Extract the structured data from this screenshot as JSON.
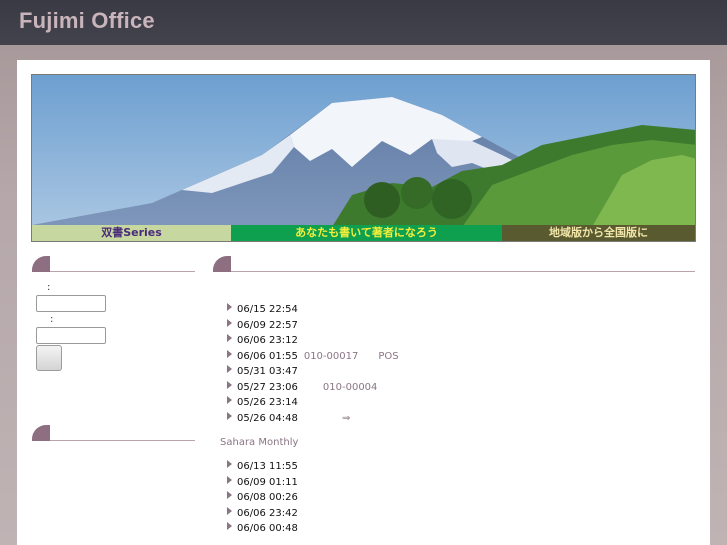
{
  "header": {
    "site_title": "Fujimi Office"
  },
  "banner": {
    "strip": [
      "双書Series",
      "あなたも書いて著者になろう",
      "地域版から全国版に"
    ]
  },
  "sidebar": {
    "login": {
      "label1": ":",
      "label2": ":",
      "field1_value": "",
      "field2_value": "",
      "button_label": ""
    }
  },
  "main": {
    "list1": [
      {
        "time": "06/15 22:54",
        "extra": "",
        "extra2": ""
      },
      {
        "time": "06/09 22:57",
        "extra": "",
        "extra2": ""
      },
      {
        "time": "06/06 23:12",
        "extra": "",
        "extra2": ""
      },
      {
        "time": "06/06 01:55",
        "extra": "010-00017",
        "extra2": "POS"
      },
      {
        "time": "05/31 03:47",
        "extra": "",
        "extra2": ""
      },
      {
        "time": "05/27 23:06",
        "extra": "      010-00004",
        "extra2": ""
      },
      {
        "time": "05/26 23:14",
        "extra": "",
        "extra2": ""
      },
      {
        "time": "05/26 04:48",
        "extra": "            ⇒",
        "extra2": ""
      }
    ],
    "magazine_label": "Sahara Monthly",
    "list2": [
      {
        "time": "06/13 11:55"
      },
      {
        "time": "06/09 01:11"
      },
      {
        "time": "06/08 00:26"
      },
      {
        "time": "06/06 23:42"
      },
      {
        "time": "06/06 00:48"
      }
    ]
  }
}
